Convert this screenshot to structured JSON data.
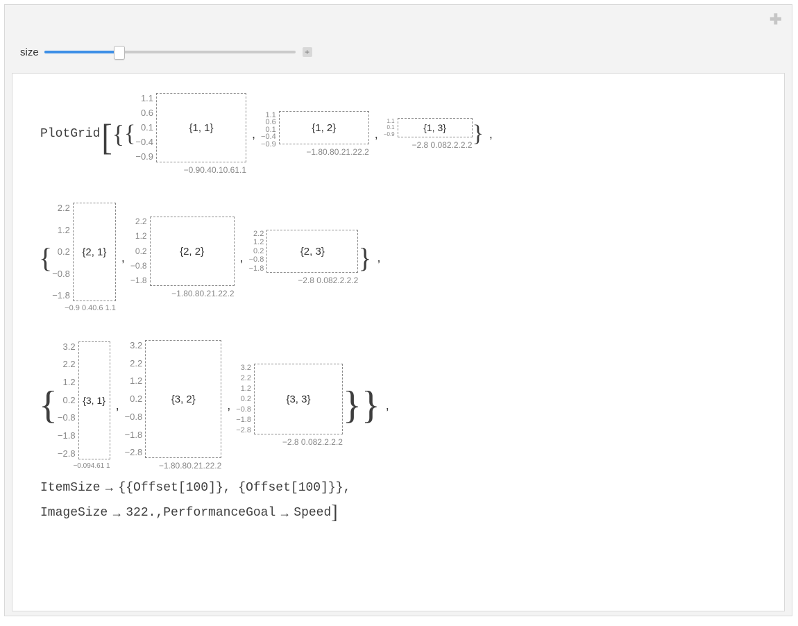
{
  "slider": {
    "label": "size"
  },
  "code": {
    "fn": "PlotGrid",
    "item_size": "ItemSize",
    "offset": "Offset",
    "offset_val": "100",
    "image_size": "ImageSize",
    "image_size_val": "322.",
    "perf_goal": "PerformanceGoal",
    "perf_goal_val": "Speed",
    "arrow": "→"
  },
  "rows": {
    "r1": {
      "cells": [
        {
          "label": "{1, 1}",
          "yticks": [
            "1.1",
            "0.6",
            "0.1",
            "−0.4",
            "−0.9"
          ],
          "xticks": "−0.90.40.10.61.1"
        },
        {
          "label": "{1, 2}",
          "yticks": [
            "1.1",
            "0.6",
            "0.1",
            "−0.4",
            "−0.9"
          ],
          "xticks": "−1.80.80.21.22.2"
        },
        {
          "label": "{1, 3}",
          "yticks": [
            "1.1",
            "0.6",
            "0.1",
            "−0.4",
            "−0.9"
          ],
          "xticks": "−2.8 0.082.2.2.2"
        }
      ]
    },
    "r2": {
      "cells": [
        {
          "label": "{2, 1}",
          "yticks": [
            "2.2",
            "1.2",
            "0.2",
            "−0.8",
            "−1.8"
          ],
          "xticks": "−0.9 0.40.6 1.1"
        },
        {
          "label": "{2, 2}",
          "yticks": [
            "2.2",
            "1.2",
            "0.2",
            "−0.8",
            "−1.8"
          ],
          "xticks": "−1.80.80.21.22.2"
        },
        {
          "label": "{2, 3}",
          "yticks": [
            "2.2",
            "1.2",
            "0.2",
            "−0.8",
            "−1.8"
          ],
          "xticks": "−2.8 0.082.2.2.2"
        }
      ]
    },
    "r3": {
      "cells": [
        {
          "label": "{3, 1}",
          "yticks": [
            "3.2",
            "2.2",
            "1.2",
            "0.2",
            "−0.8",
            "−1.8",
            "−2.8"
          ],
          "xticks": "−0.094.61 1"
        },
        {
          "label": "{3, 2}",
          "yticks": [
            "3.2",
            "2.2",
            "1.2",
            "0.2",
            "−0.8",
            "−1.8",
            "−2.8"
          ],
          "xticks": "−1.80.80.21.22.2"
        },
        {
          "label": "{3, 3}",
          "yticks": [
            "3.2",
            "2.2",
            "1.2",
            "0.2",
            "−0.8",
            "−1.8",
            "−2.8"
          ],
          "xticks": "−2.8 0.082.2.2.2"
        }
      ]
    }
  }
}
